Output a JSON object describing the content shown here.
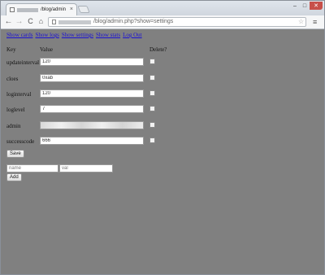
{
  "browser": {
    "tab_title": "/blog/admin",
    "tab_close": "×",
    "url": "/blog/admin.php?show=settings",
    "min": "–",
    "max": "□",
    "close": "✕"
  },
  "nav": {
    "show_cards": "Show cards",
    "show_logs": "Show logs",
    "show_settings": "Show settings",
    "show_stats": "Show stats",
    "log_out": "Log Out"
  },
  "table": {
    "headers": {
      "key": "Key",
      "value": "Value",
      "delete": "Delete?"
    },
    "rows": [
      {
        "key": "updateinterval",
        "value": "120"
      },
      {
        "key": "cloes",
        "value": "0xab"
      },
      {
        "key": "loginterval",
        "value": "120"
      },
      {
        "key": "loglevel",
        "value": "7"
      },
      {
        "key": "admin",
        "value": ""
      },
      {
        "key": "successcode",
        "value": "666"
      }
    ]
  },
  "save_label": "Save",
  "new_setting": {
    "name_placeholder": "name",
    "value_placeholder": "val",
    "add_label": "Add"
  },
  "icons": {
    "back": "←",
    "forward": "→",
    "reload": "C",
    "home": "⌂",
    "star": "☆",
    "menu": "≡"
  },
  "colors": {
    "page_background": "#808080",
    "link": "#1a10d6"
  }
}
